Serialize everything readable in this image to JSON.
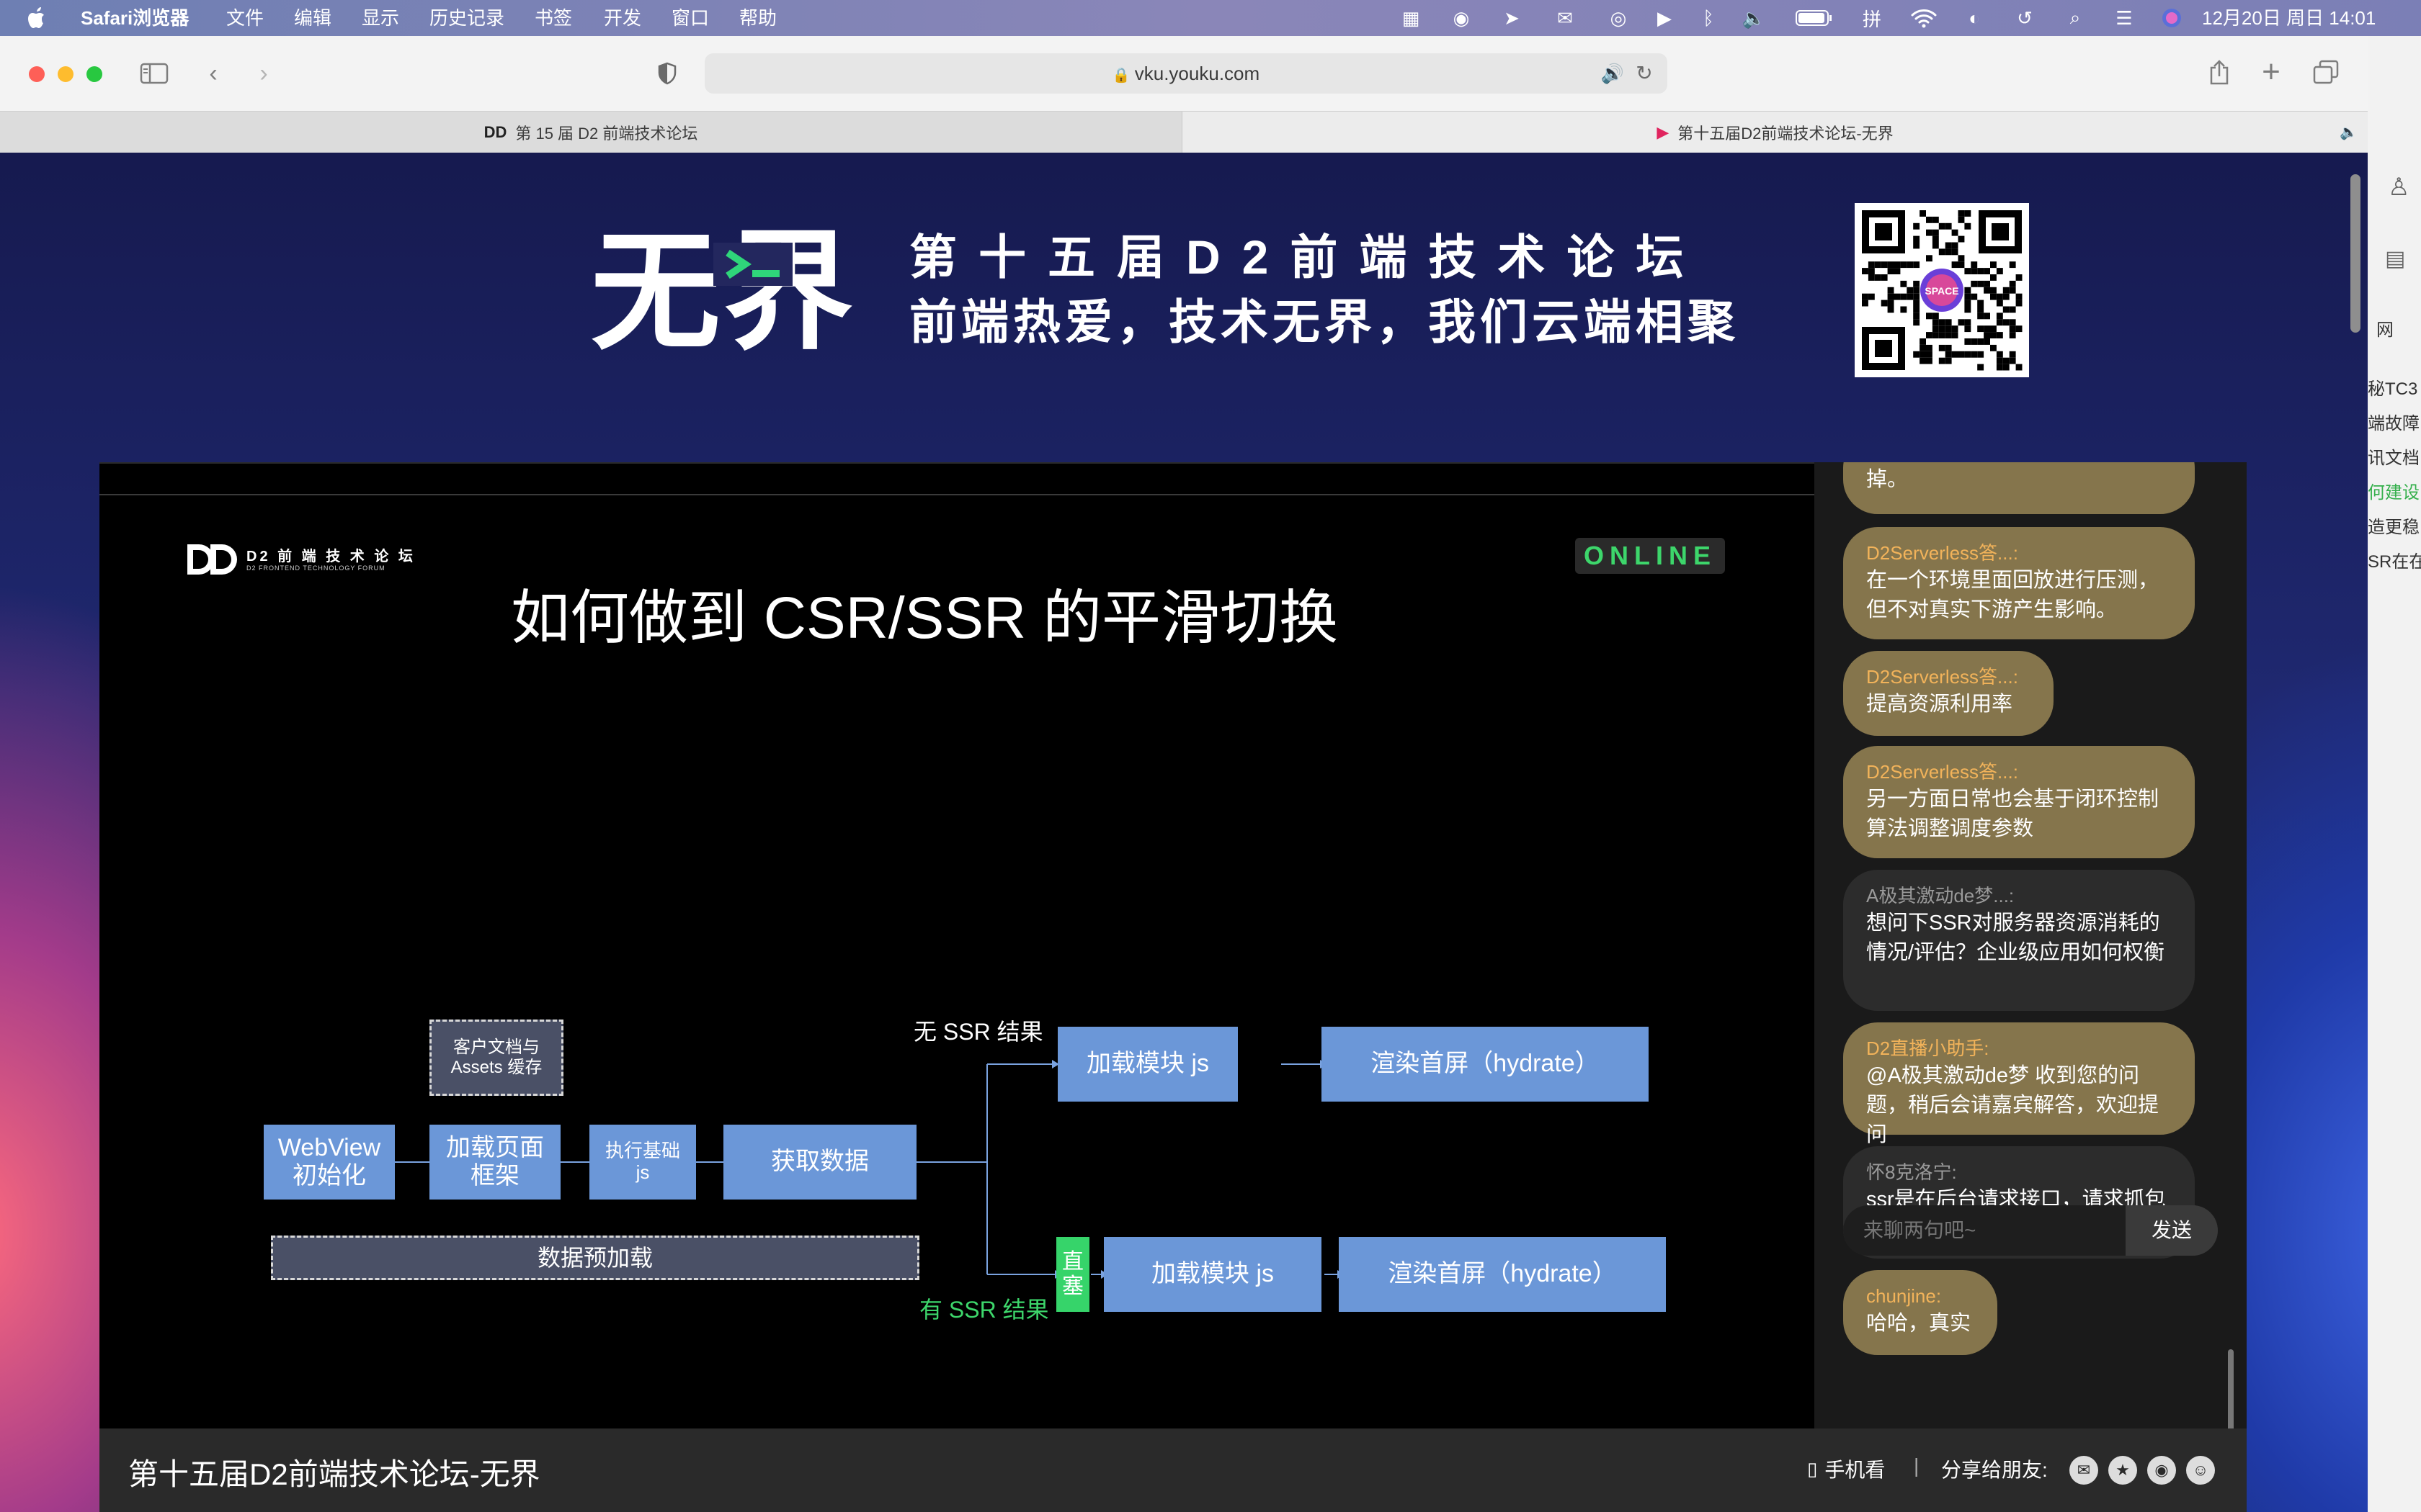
{
  "menubar": {
    "app_name": "Safari浏览器",
    "menus": [
      "文件",
      "编辑",
      "显示",
      "历史记录",
      "书签",
      "开发",
      "窗口",
      "帮助"
    ],
    "datetime": "12月20日 周日  14:01"
  },
  "browser": {
    "url": "vku.youku.com",
    "tabs": [
      "第 15 届 D2 前端技术论坛",
      "第十五届D2前端技术论坛-无界"
    ]
  },
  "banner": {
    "logo_text": "无界",
    "line1": "第十五届D2前端技术论坛",
    "line2": "前端热爱，技术无界，我们云端相聚",
    "qr_center_label": "SPACE"
  },
  "slide": {
    "logo_title": "D2 前 端 技 术 论 坛",
    "logo_subtitle": "D2 FRONTEND TECHNOLOGY FORUM",
    "badge": "ONLINE",
    "title": "如何做到 CSR/SSR 的平滑切换",
    "diagram": {
      "cache_line1": "客户文档与",
      "cache_line2": "Assets 缓存",
      "webview_line1": "WebView",
      "webview_line2": "初始化",
      "load_frame_line1": "加载页面",
      "load_frame_line2": "框架",
      "exec_js_line1": "执行基础",
      "exec_js_line2": "js",
      "fetch_data": "获取数据",
      "preload": "数据预加载",
      "no_ssr": "无 SSR 结果",
      "has_ssr": "有 SSR 结果",
      "inject_line1": "直",
      "inject_line2": "塞",
      "load_module_top": "加载模块 js",
      "render_top": "渲染首屏（hydrate）",
      "load_module_bottom": "加载模块 js",
      "render_bottom": "渲染首屏（hydrate）"
    }
  },
  "chat": {
    "messages": [
      {
        "name": "",
        "text": "掉。",
        "style": "gold"
      },
      {
        "name": "D2Serverless答...:",
        "text": "在一个环境里面回放进行压测，但不对真实下游产生影响。",
        "style": "gold"
      },
      {
        "name": "D2Serverless答...:",
        "text": "提高资源利用率",
        "style": "gold"
      },
      {
        "name": "D2Serverless答...:",
        "text": "另一方面日常也会基于闭环控制算法调整调度参数",
        "style": "gold"
      },
      {
        "name": "A极其激动de梦...:",
        "text": "想问下SSR对服务器资源消耗的情况/评估？企业级应用如何权衡",
        "style": "dark"
      },
      {
        "name": "D2直播小助手:",
        "text": "@A极其激动de梦 收到您的问题，稍后会请嘉宾解答，欢迎提问",
        "style": "gold"
      },
      {
        "name": "怀8克洛宁:",
        "text": "ssr是在后台请求接口，请求抓包分析有什么好方法吗？",
        "style": "dark"
      },
      {
        "name": "chunjine:",
        "text": "哈哈，真实",
        "style": "gold"
      }
    ],
    "input_placeholder": "来聊两句吧~",
    "send_label": "发送"
  },
  "footer": {
    "video_title": "第十五届D2前端技术论坛-无界",
    "mobile_label": "手机看",
    "separator": "|",
    "share_label": "分享给朋友:"
  },
  "side_strip": {
    "lines": [
      "秘TC3",
      "端故障",
      "讯文档",
      "何建设",
      "造更稳",
      "SR在在"
    ],
    "header": "网"
  },
  "colors": {
    "accent_green": "#3dd66b",
    "box_blue": "#6b97d8",
    "chat_gold": "#85754c",
    "chat_name_gold": "#f2b35a"
  }
}
